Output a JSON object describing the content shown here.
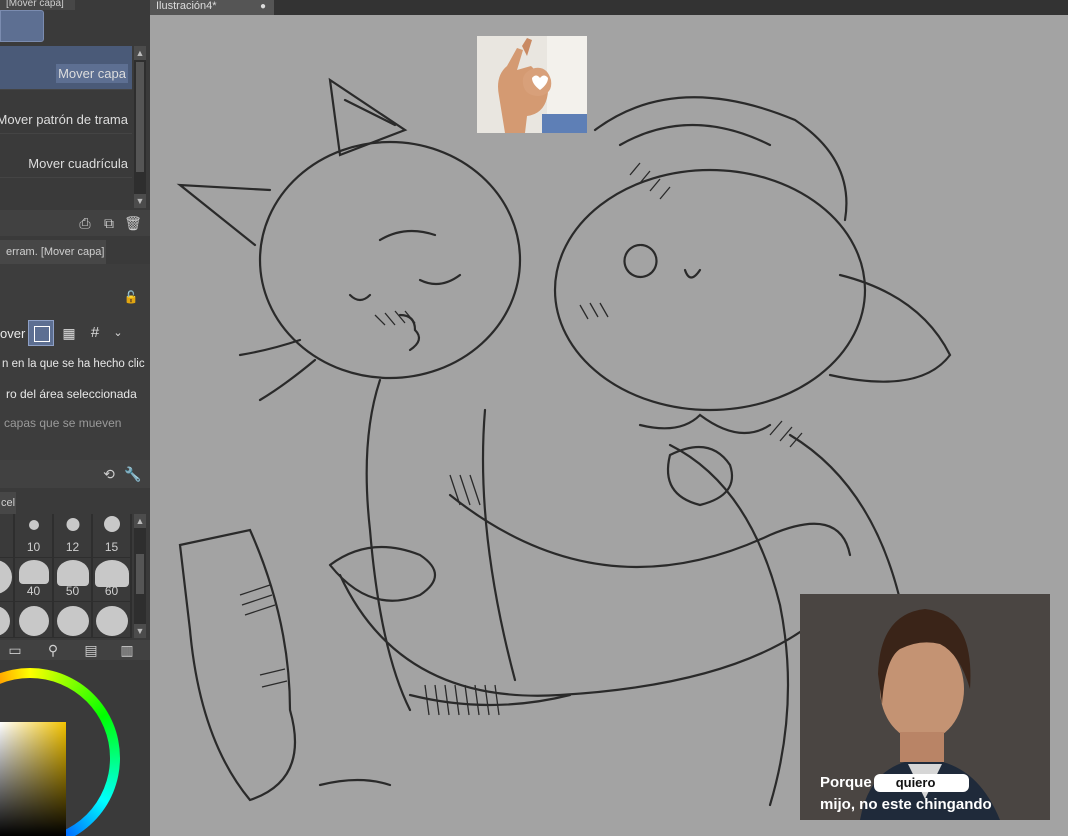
{
  "tool_panel": {
    "header_tab": "[Mover capa]",
    "items": [
      {
        "label": "Mover capa",
        "active": true
      },
      {
        "label": "Mover patrón de trama",
        "active": false
      },
      {
        "label": "Mover cuadrícula",
        "active": false
      }
    ],
    "footer_icons": [
      "export-icon",
      "duplicate-icon",
      "trash-icon"
    ]
  },
  "tool_property": {
    "tab": "erram. [Mover capa]",
    "rows": [
      {
        "label": "over",
        "kind": "mode"
      },
      {
        "label": "n en la que se ha hecho clic"
      },
      {
        "label": "ro del área seleccionada"
      },
      {
        "label": "capas que se mueven",
        "dim": true
      }
    ]
  },
  "brush_panel": {
    "tab": "cel",
    "sizes_row1": [
      "10",
      "12",
      "15"
    ],
    "sizes_row2": [
      "40",
      "50",
      "60"
    ]
  },
  "document": {
    "tab_title": "Ilustración4*"
  },
  "meme": {
    "line1_prefix": "Porque",
    "line1_redacted": "quiero",
    "line2": "mijo, no este chingando"
  },
  "colors": {
    "panel_bg": "#3a3a3a",
    "canvas_bg": "#a3a3a3",
    "accent": "#5d6f92"
  }
}
